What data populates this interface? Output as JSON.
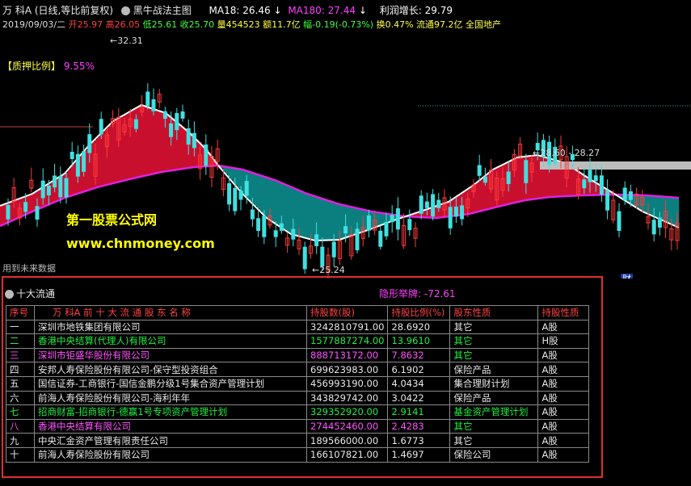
{
  "header": {
    "stock_name": "万 科A",
    "period_mode": "(日线,等比前复权)",
    "indicator_name": "黑牛战法主图",
    "ma18_label": "MA18:",
    "ma18_value": "26.46",
    "ma180_label": "MA180:",
    "ma180_value": "27.44",
    "profit_growth_label": "利润增长:",
    "profit_growth_value": "29.79"
  },
  "quote": {
    "date": "2019/09/03/二",
    "open": "开25.97",
    "high": "高26.05",
    "low": "低25.61",
    "close": "收25.70",
    "volume": "量454523",
    "amount": "额11.7亿",
    "change": "幅-0.19(-0.73%)",
    "turnover": "换0.47%",
    "float_cap": "流通97.2亿",
    "sector": "全国地产"
  },
  "chart": {
    "pledge_label": "【质押比例】",
    "pledge_value": "9.55%",
    "high_mark": "32.31",
    "low_mark": "25.24",
    "range_mark": "28.60 - 28.27",
    "watermark_title": "第一股票公式网",
    "watermark_url": "www.chnmoney.com",
    "future_data_note": "用到未来数据",
    "finance_marker": "财",
    "colors": {
      "bull_fill": "#c8102e",
      "bear_fill": "#0b7f7f",
      "ma18_line": "#ffffff",
      "ma180_line": "#e020e0",
      "up_candle": "#ff3a3a",
      "down_candle": "#40e0e0"
    }
  },
  "panel": {
    "title": "十大流通",
    "hidden_lift_label": "隐形举牌:",
    "hidden_lift_value": "-72.61",
    "columns": [
      "序号",
      "万 科A  前 十 大 流 通 股 东 名 称",
      "持股数(股)",
      "持股比例(%)",
      "股东性质",
      "持股性质"
    ],
    "rows": [
      {
        "idx": "一",
        "name": "深圳市地铁集团有限公司",
        "shares": "3242810791.00",
        "ratio": "28.6920",
        "nature": "其它",
        "type": "A股"
      },
      {
        "idx": "二",
        "name": "香港中央结算(代理人)有限公司",
        "shares": "1577887274.00",
        "ratio": "13.9610",
        "nature": "其它",
        "type": "H股"
      },
      {
        "idx": "三",
        "name": "深圳市钜盛华股份有限公司",
        "shares": "888713172.00",
        "ratio": "7.8632",
        "nature": "其它",
        "type": "A股"
      },
      {
        "idx": "四",
        "name": "安邦人寿保险股份有限公司-保守型投资组合",
        "shares": "699623983.00",
        "ratio": "6.1902",
        "nature": "保险产品",
        "type": "A股"
      },
      {
        "idx": "五",
        "name": "国信证券-工商银行-国信金鹏分级1号集合资产管理计划",
        "shares": "456993190.00",
        "ratio": "4.0434",
        "nature": "集合理财计划",
        "type": "A股"
      },
      {
        "idx": "六",
        "name": "前海人寿保险股份有限公司-海利年年",
        "shares": "343829742.00",
        "ratio": "3.0422",
        "nature": "保险产品",
        "type": "A股"
      },
      {
        "idx": "七",
        "name": "招商财富-招商银行-德赢1号专项资产管理计划",
        "shares": "329352920.00",
        "ratio": "2.9141",
        "nature": "基金资产管理计划",
        "type": "A股"
      },
      {
        "idx": "八",
        "name": "香港中央结算有限公司",
        "shares": "274452460.00",
        "ratio": "2.4283",
        "nature": "其它",
        "type": "A股"
      },
      {
        "idx": "九",
        "name": "中央汇金资产管理有限责任公司",
        "shares": "189566000.00",
        "ratio": "1.6773",
        "nature": "其它",
        "type": "A股"
      },
      {
        "idx": "十",
        "name": "前海人寿保险股份有限公司",
        "shares": "166107821.00",
        "ratio": "1.4697",
        "nature": "保险公司",
        "type": "A股"
      }
    ]
  }
}
